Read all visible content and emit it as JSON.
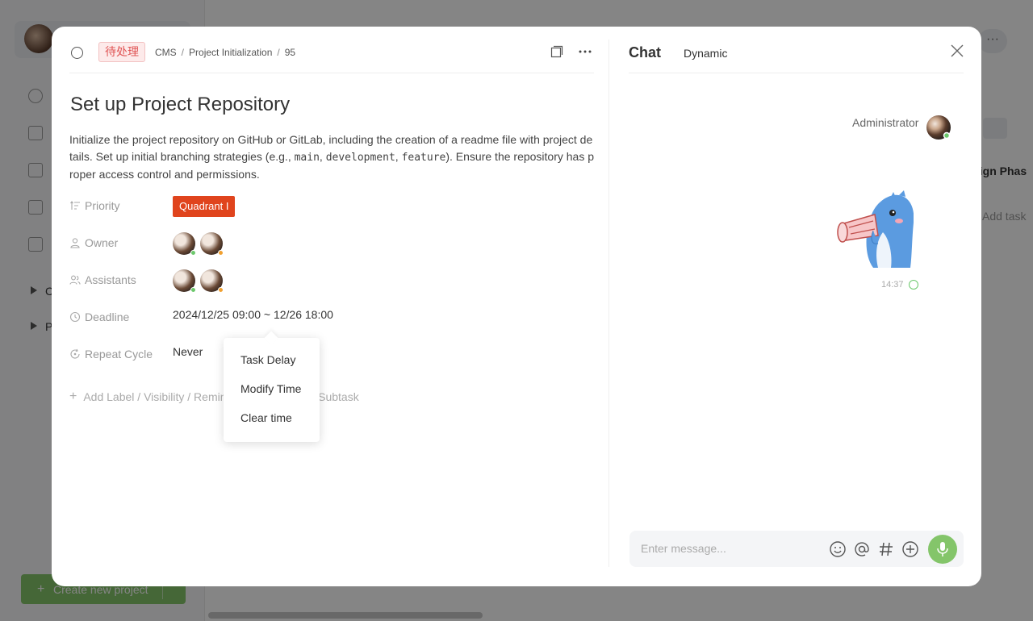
{
  "background": {
    "create_label": "Create new project",
    "sidebar_groups": [
      {
        "label": "C"
      },
      {
        "label": "P"
      }
    ],
    "right_texts": [
      "sign Phas",
      "Add task"
    ]
  },
  "header": {
    "status": "待处理",
    "breadcrumb": [
      "CMS",
      "Project Initialization",
      "95"
    ]
  },
  "task": {
    "title": "Set up Project Repository",
    "desc_parts": {
      "p1": "Initialize the project repository on GitHub or GitLab, including the creation of a readme file with project details. Set up initial branching strategies (e.g., ",
      "c1": "main",
      "p2": ", ",
      "c2": "development",
      "p3": ", ",
      "c3": "feature",
      "p4": "). Ensure the repository has proper access control and permissions."
    }
  },
  "fields": {
    "priority_label": "Priority",
    "priority_value": "Quadrant I",
    "owner_label": "Owner",
    "assistants_label": "Assistants",
    "deadline_label": "Deadline",
    "deadline_value": "2024/12/25 09:00 ~ 12/26 18:00",
    "repeat_label": "Repeat Cycle",
    "repeat_value": "Never",
    "add_more": "Add Label / Visibility / Reminder / Attachment / Subtask"
  },
  "popup": {
    "items": [
      "Task Delay",
      "Modify Time",
      "Clear time"
    ]
  },
  "chat": {
    "tab_active": "Chat",
    "tab_other": "Dynamic",
    "sender": "Administrator",
    "time": "14:37",
    "input_placeholder": "Enter message..."
  },
  "colors": {
    "accent": "#84c56a",
    "priority": "#e0441d",
    "status_text": "#e05555",
    "online": "#6cc86c",
    "away": "#f0a030"
  }
}
